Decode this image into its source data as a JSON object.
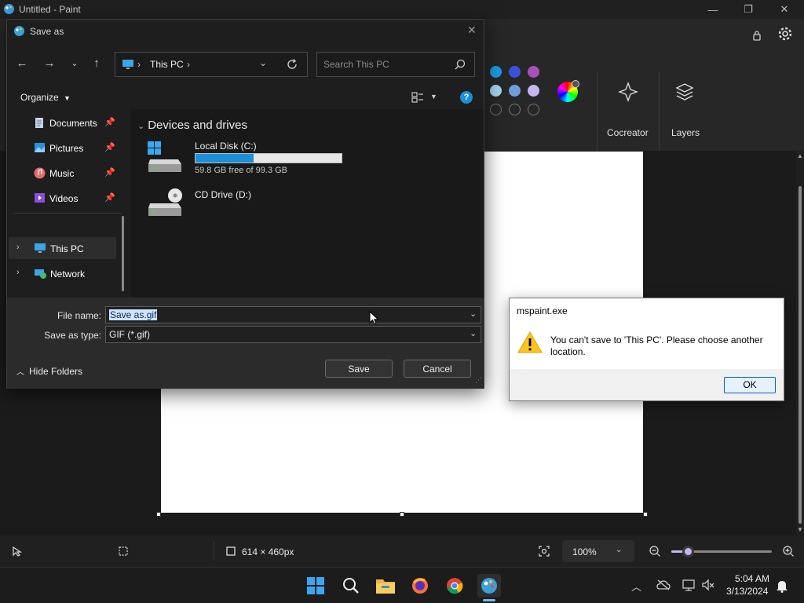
{
  "paint": {
    "title": "Untitled - Paint",
    "ribbon": {
      "cocreator_label": "Cocreator",
      "layers_label": "Layers",
      "swatches": [
        "#1b9be6",
        "#3b52d8",
        "#a84fb8",
        "#a3d5ef",
        "#6e9fdc",
        "#c7b7ef"
      ]
    },
    "status": {
      "canvas_size": "614 × 460px",
      "zoom": "100%"
    }
  },
  "save_dialog": {
    "title": "Save as",
    "address": {
      "location": "This PC",
      "separator": "›"
    },
    "search_placeholder": "Search This PC",
    "organize_label": "Organize",
    "nav_items": [
      {
        "label": "Documents",
        "pinned": true
      },
      {
        "label": "Pictures",
        "pinned": true
      },
      {
        "label": "Music",
        "pinned": true
      },
      {
        "label": "Videos",
        "pinned": true
      },
      {
        "label": "This PC",
        "pinned": false
      },
      {
        "label": "Network",
        "pinned": false
      }
    ],
    "group_header": "Devices and drives",
    "drives": [
      {
        "name": "Local Disk (C:)",
        "free_text": "59.8 GB free of 99.3 GB",
        "used_fraction": 0.398
      },
      {
        "name": "CD Drive (D:)"
      }
    ],
    "file_name_label": "File name:",
    "file_name_value": "Save as.gif",
    "save_type_label": "Save as type:",
    "save_type_value": "GIF (*.gif)",
    "hide_folders_label": "Hide Folders",
    "save_button": "Save",
    "cancel_button": "Cancel"
  },
  "message_box": {
    "title": "mspaint.exe",
    "message": "You can't save to 'This PC'. Please choose another location.",
    "ok_button": "OK"
  },
  "taskbar": {
    "time": "5:04 AM",
    "date": "3/13/2024"
  },
  "colors": {
    "accent": "#1c8fd8",
    "dialog_bg": "#1e1e1e",
    "selection": "#cfe3fa"
  }
}
